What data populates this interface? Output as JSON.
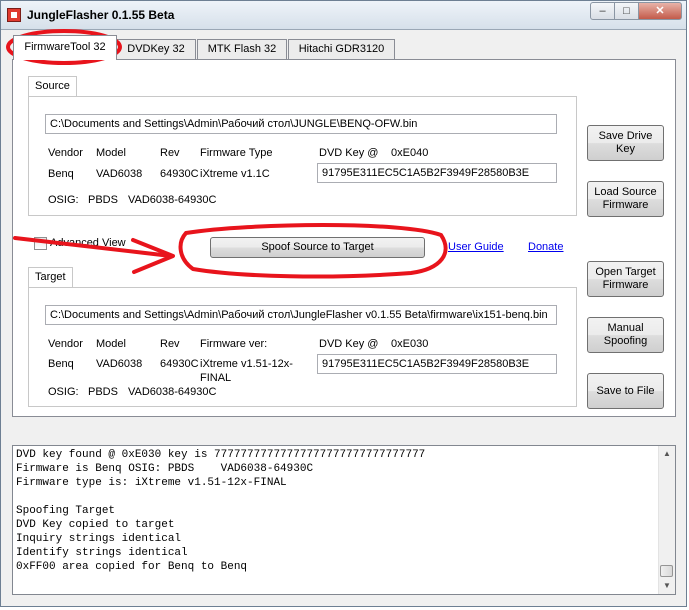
{
  "window": {
    "title": "JungleFlasher 0.1.55 Beta",
    "controls": {
      "minimize": "–",
      "maximize": "□",
      "close": "✕"
    }
  },
  "tabs": [
    {
      "label": "FirmwareTool 32",
      "active": true
    },
    {
      "label": "DVDKey 32",
      "active": false
    },
    {
      "label": "MTK Flash 32",
      "active": false
    },
    {
      "label": "Hitachi GDR3120",
      "active": false
    }
  ],
  "source": {
    "group_label": "Source",
    "path": "C:\\Documents and Settings\\Admin\\Рабочий стол\\JUNGLE\\BENQ-OFW.bin",
    "headers": {
      "vendor": "Vendor",
      "model": "Model",
      "rev": "Rev",
      "fw_type": "Firmware Type",
      "dvd_key": "DVD Key @",
      "dvd_key_addr": "0xE040"
    },
    "vendor": "Benq",
    "model": "VAD6038",
    "rev": "64930C",
    "fw_type": "iXtreme v1.1C",
    "dvd_key": "91795E311EC5C1A5B2F3949F28580B3E",
    "osig_label": "OSIG:",
    "osig_vendor": "PBDS",
    "osig_model": "VAD6038-64930C"
  },
  "target": {
    "group_label": "Target",
    "path": "C:\\Documents and Settings\\Admin\\Рабочий стол\\JungleFlasher v0.1.55 Beta\\firmware\\ix151-benq.bin",
    "headers": {
      "vendor": "Vendor",
      "model": "Model",
      "rev": "Rev",
      "fw_type": "Firmware ver:",
      "dvd_key": "DVD Key @",
      "dvd_key_addr": "0xE030"
    },
    "vendor": "Benq",
    "model": "VAD6038",
    "rev": "64930C",
    "fw_type_line1": "iXtreme v1.51-12x-",
    "fw_type_line2": "FINAL",
    "dvd_key": "91795E311EC5C1A5B2F3949F28580B3E",
    "osig_label": "OSIG:",
    "osig_vendor": "PBDS",
    "osig_model": "VAD6038-64930C"
  },
  "middle": {
    "advanced_view": "Advanced View",
    "spoof_button": "Spoof Source to Target",
    "user_guide": "User Guide",
    "donate": "Donate"
  },
  "buttons": {
    "save_drive_key": "Save Drive Key",
    "load_source_1": "Load Source",
    "load_source_2": "Firmware",
    "open_target_1": "Open Target",
    "open_target_2": "Firmware",
    "manual_spoof_1": "Manual",
    "manual_spoof_2": "Spoofing",
    "save_to_file": "Save to File"
  },
  "log": {
    "lines": [
      "DVD key found @ 0xE030 key is 77777777777777777777777777777777",
      "Firmware is Benq OSIG: PBDS    VAD6038-64930C",
      "Firmware type is: iXtreme v1.51-12x-FINAL",
      "",
      "Spoofing Target",
      "DVD Key copied to target",
      "Inquiry strings identical",
      "Identify strings identical",
      "0xFF00 area copied for Benq to Benq"
    ]
  },
  "colors": {
    "annotation": "#e8141c",
    "link": "#0000ee"
  }
}
